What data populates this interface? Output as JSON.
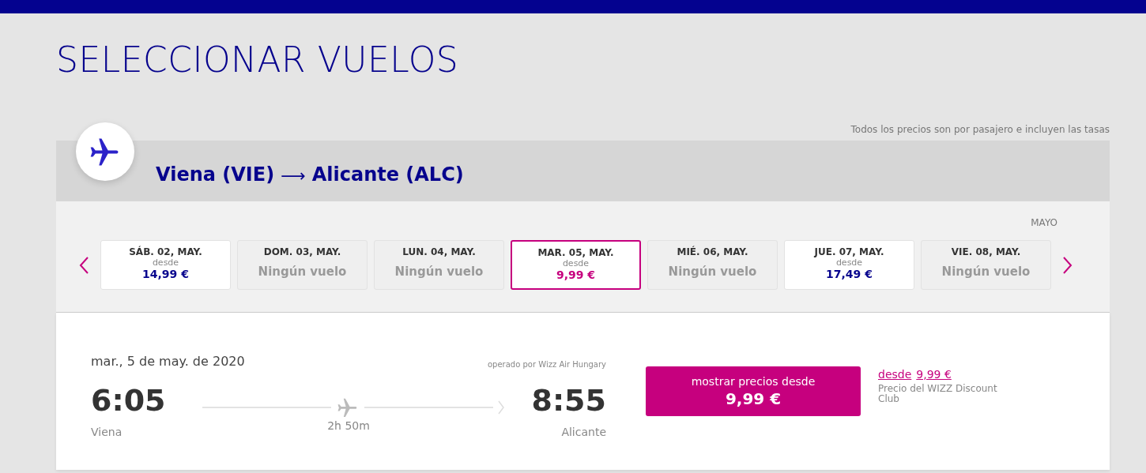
{
  "title": "SELECCIONAR VUELOS",
  "note": "Todos los precios son por pasajero e incluyen las tasas",
  "route": {
    "origin": "Viena (VIE)",
    "arrow": "⟶",
    "destination": "Alicante (ALC)"
  },
  "month": "MAYO",
  "days": [
    {
      "label": "SÁB. 02, MAY.",
      "kind": "available",
      "from": "desde",
      "price": "14,99 €",
      "selected": false
    },
    {
      "label": "DOM. 03, MAY.",
      "kind": "none",
      "status": "Ningún vuelo",
      "selected": false
    },
    {
      "label": "LUN. 04, MAY.",
      "kind": "none",
      "status": "Ningún vuelo",
      "selected": false
    },
    {
      "label": "MAR. 05, MAY.",
      "kind": "available",
      "from": "desde",
      "price": "9,99 €",
      "selected": true
    },
    {
      "label": "MIÉ. 06, MAY.",
      "kind": "none",
      "status": "Ningún vuelo",
      "selected": false
    },
    {
      "label": "JUE. 07, MAY.",
      "kind": "available",
      "from": "desde",
      "price": "17,49 €",
      "selected": false
    },
    {
      "label": "VIE. 08, MAY.",
      "kind": "none",
      "status": "Ningún vuelo",
      "selected": false
    }
  ],
  "flight": {
    "date": "mar., 5 de may. de 2020",
    "operator": "operado por Wizz Air Hungary",
    "departure_time": "6:05",
    "departure_city": "Viena",
    "duration": "2h 50m",
    "arrival_time": "8:55",
    "arrival_city": "Alicante",
    "button_label": "mostrar precios desde",
    "button_price": "9,99 €",
    "club_from": "desde",
    "club_price": "9,99 €",
    "club_note": "Precio del WIZZ Discount Club"
  }
}
